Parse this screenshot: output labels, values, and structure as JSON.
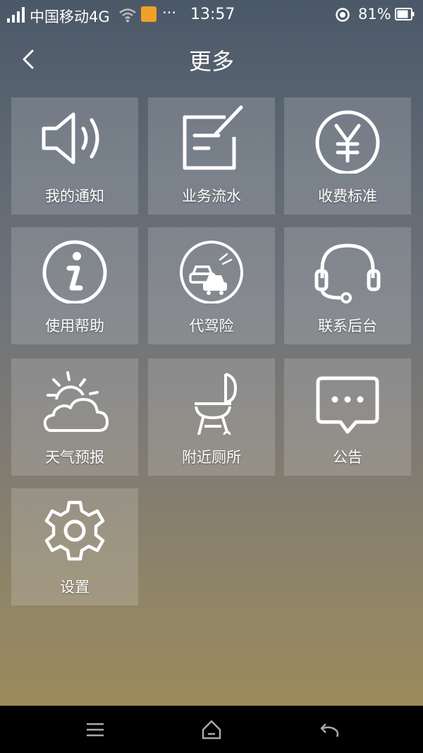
{
  "status_bar": {
    "carrier": "中国移动4G",
    "dots": "···",
    "time": "13:57",
    "battery": "81%"
  },
  "header": {
    "title": "更多"
  },
  "tiles": [
    {
      "label": "我的通知",
      "icon": "speaker-icon"
    },
    {
      "label": "业务流水",
      "icon": "edit-note-icon"
    },
    {
      "label": "收费标准",
      "icon": "yen-icon"
    },
    {
      "label": "使用帮助",
      "icon": "info-icon"
    },
    {
      "label": "代驾险",
      "icon": "cars-icon"
    },
    {
      "label": "联系后台",
      "icon": "headset-icon"
    },
    {
      "label": "天气预报",
      "icon": "weather-icon"
    },
    {
      "label": "附近厕所",
      "icon": "grill-icon"
    },
    {
      "label": "公告",
      "icon": "chat-bubble-icon"
    },
    {
      "label": "设置",
      "icon": "gear-icon"
    }
  ],
  "nav_bar": {
    "icons": [
      "menu-icon",
      "home-icon",
      "back-arrow-icon"
    ]
  }
}
